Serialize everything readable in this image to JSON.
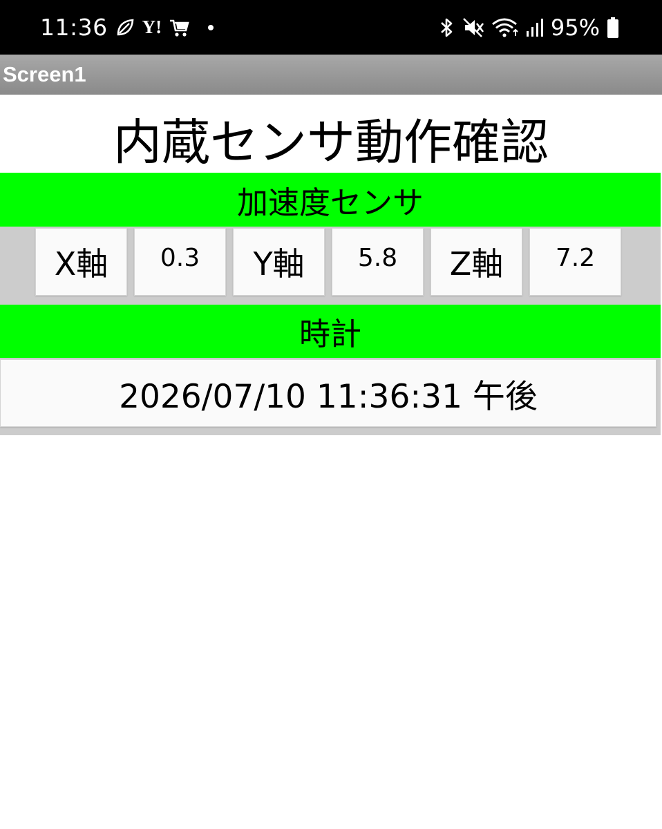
{
  "status_bar": {
    "time": "11:36",
    "notification_icons": [
      "leaf-icon",
      "yahoo-icon",
      "shopping-cart-icon",
      "dot-icon"
    ],
    "system_icons": [
      "bluetooth-icon",
      "mute-icon",
      "wifi-icon",
      "signal-icon",
      "battery-icon"
    ],
    "yahoo_logo": "Y!",
    "battery_percent": "95%"
  },
  "app_bar": {
    "title": "Screen1"
  },
  "page": {
    "title": "内蔵センサ動作確認",
    "accel_section": {
      "header": "加速度センサ",
      "x_label": "X軸",
      "x_value": "0.3",
      "y_label": "Y軸",
      "y_value": "5.8",
      "z_label": "Z軸",
      "z_value": "7.2"
    },
    "clock_section": {
      "header": "時計",
      "datetime": "2026/07/10 11:36:31 午後"
    }
  },
  "colors": {
    "status_bar_bg": "#000000",
    "app_bar_bg": "#9a9a9a",
    "section_header_bg": "#00ff00",
    "row_bg": "#cccccc",
    "cell_bg": "#fafafa"
  }
}
